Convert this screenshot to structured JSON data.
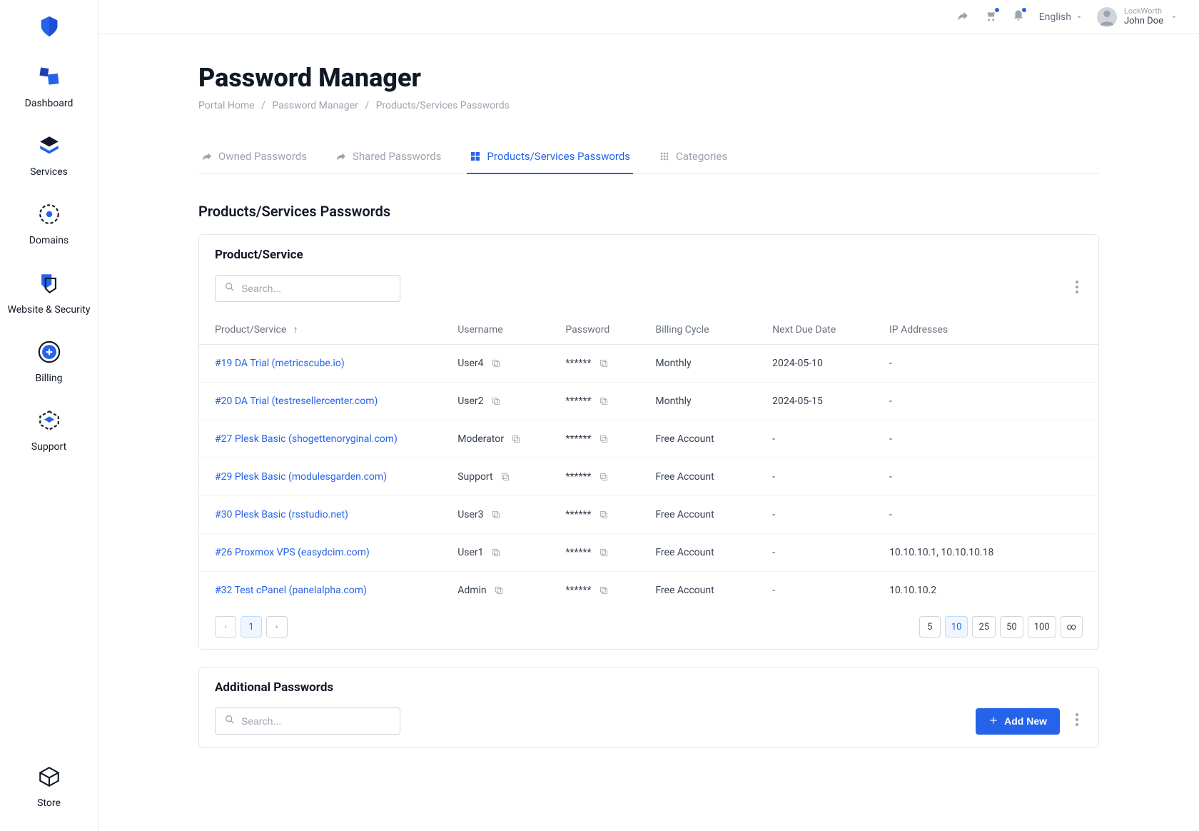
{
  "header": {
    "language": "English",
    "org": "LockWorth",
    "user_name": "John Doe"
  },
  "sidebar": {
    "items": [
      {
        "label": "Dashboard"
      },
      {
        "label": "Services"
      },
      {
        "label": "Domains"
      },
      {
        "label": "Website & Security"
      },
      {
        "label": "Billing"
      },
      {
        "label": "Support"
      }
    ],
    "store_label": "Store"
  },
  "page": {
    "title": "Password Manager",
    "breadcrumb": {
      "home": "Portal Home",
      "parent": "Password Manager",
      "current": "Products/Services Passwords"
    }
  },
  "tabs": [
    {
      "label": "Owned Passwords"
    },
    {
      "label": "Shared Passwords"
    },
    {
      "label": "Products/Services Passwords"
    },
    {
      "label": "Categories"
    }
  ],
  "section_title": "Products/Services Passwords",
  "product_panel": {
    "title": "Product/Service",
    "search_placeholder": "Search...",
    "columns": {
      "product": "Product/Service",
      "username": "Username",
      "password": "Password",
      "billing": "Billing Cycle",
      "due": "Next Due Date",
      "ips": "IP Addresses"
    },
    "rows": [
      {
        "product": "#19 DA Trial (metricscube.io)",
        "username": "User4",
        "password": "******",
        "billing": "Monthly",
        "due": "2024-05-10",
        "ips": "-"
      },
      {
        "product": "#20 DA Trial (testresellercenter.com)",
        "username": "User2",
        "password": "******",
        "billing": "Monthly",
        "due": "2024-05-15",
        "ips": "-"
      },
      {
        "product": "#27 Plesk Basic (shogettenoryginal.com)",
        "username": "Moderator",
        "password": "******",
        "billing": "Free Account",
        "due": "-",
        "ips": "-"
      },
      {
        "product": "#29 Plesk Basic (modulesgarden.com)",
        "username": "Support",
        "password": "******",
        "billing": "Free Account",
        "due": "-",
        "ips": "-"
      },
      {
        "product": "#30 Plesk Basic (rsstudio.net)",
        "username": "User3",
        "password": "******",
        "billing": "Free Account",
        "due": "-",
        "ips": "-"
      },
      {
        "product": "#26 Proxmox VPS (easydcim.com)",
        "username": "User1",
        "password": "******",
        "billing": "Free Account",
        "due": "-",
        "ips": "10.10.10.1, 10.10.10.18"
      },
      {
        "product": "#32 Test cPanel (panelalpha.com)",
        "username": "Admin",
        "password": "******",
        "billing": "Free Account",
        "due": "-",
        "ips": "10.10.10.2"
      }
    ],
    "pager": {
      "current": "1"
    },
    "page_sizes": [
      "5",
      "10",
      "25",
      "50",
      "100",
      "∞"
    ],
    "page_size_active": "10"
  },
  "additional_panel": {
    "title": "Additional Passwords",
    "search_placeholder": "Search...",
    "add_button": "Add New"
  }
}
